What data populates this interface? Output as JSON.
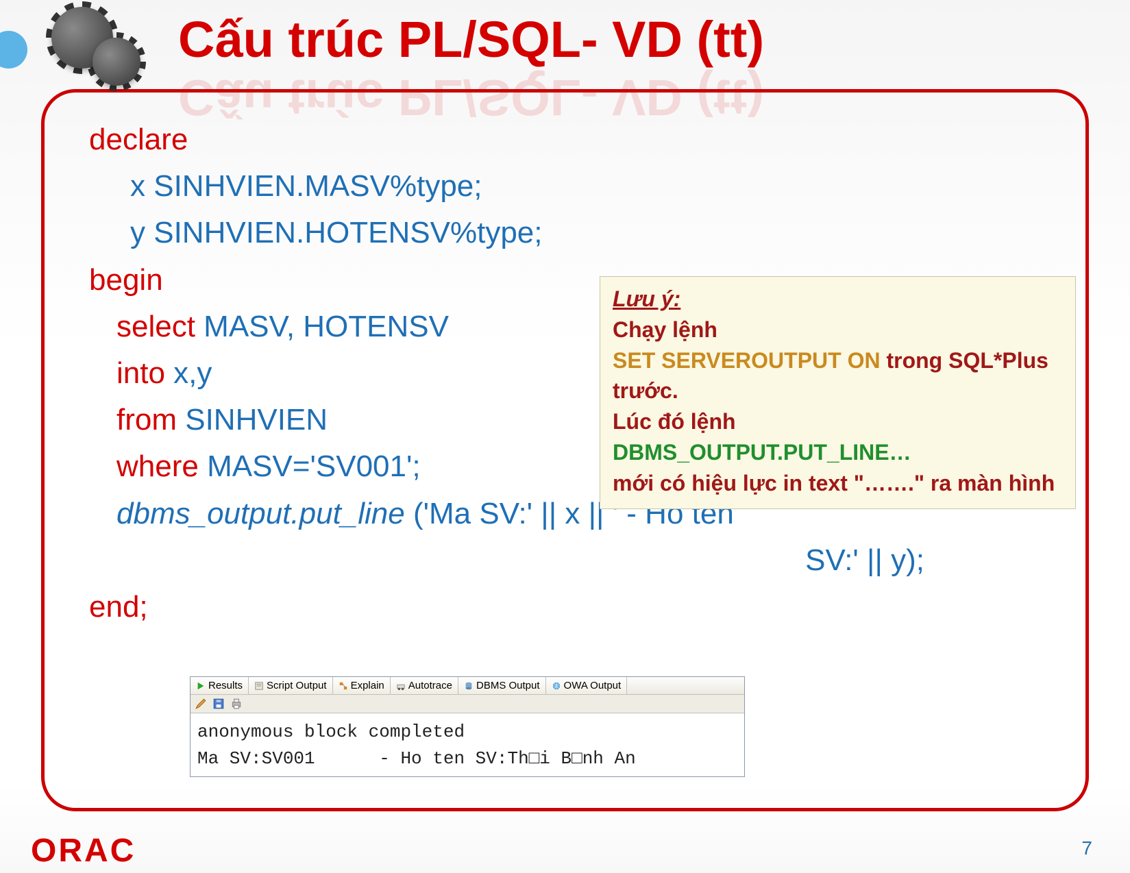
{
  "title": "Cấu trúc PL/SQL- VD (tt)",
  "code": {
    "declare": "declare",
    "x_decl_pre": "x ",
    "x_decl_blue": "SINHVIEN.MASV%type;",
    "y_decl_pre": "y ",
    "y_decl_blue": "SINHVIEN.HOTENSV%type;",
    "begin": "begin",
    "select_kw": "select ",
    "select_cols": "MASV, HOTENSV",
    "into_kw": "into ",
    "into_vars": "x,y",
    "from_kw": "from ",
    "from_tbl": "SINHVIEN",
    "where_kw": "where ",
    "where_cond": "MASV='SV001';",
    "dbms_fn": "dbms_output.put_line",
    "dbms_args1": " ('Ma SV:' || x || ' - Ho ten",
    "dbms_args2": "SV:' || y);",
    "end": "end;"
  },
  "note": {
    "title": "Lưu ý:",
    "line1": "Chạy lệnh",
    "line2a": "SET SERVEROUTPUT ON ",
    "line2b": "trong SQL*Plus trước.",
    "line3": "Lúc đó lệnh",
    "line4": "DBMS_OUTPUT.PUT_LINE…",
    "line5": "mới có hiệu lực in text \"…….\" ra màn hình"
  },
  "tabs": {
    "results": "Results",
    "script": "Script Output",
    "explain": "Explain",
    "autotrace": "Autotrace",
    "dbms": "DBMS Output",
    "owa": "OWA Output"
  },
  "output": {
    "line1": "anonymous block completed",
    "line2": "Ma SV:SV001      - Ho ten SV:Th□i B□nh An"
  },
  "brand": "ORAC",
  "page_number": "7"
}
